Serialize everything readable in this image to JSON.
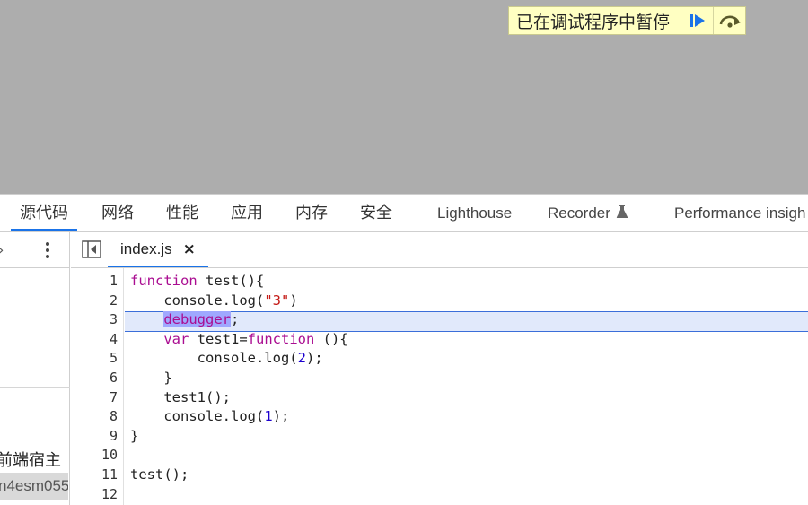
{
  "overlay": {
    "paused_text": "已在调试程序中暂停",
    "resume_icon": "resume-icon",
    "step_over_icon": "step-over-icon"
  },
  "tabs": [
    {
      "label": "源代码",
      "active": true
    },
    {
      "label": "网络"
    },
    {
      "label": "性能"
    },
    {
      "label": "应用"
    },
    {
      "label": "内存"
    },
    {
      "label": "安全"
    },
    {
      "label": "Lighthouse"
    },
    {
      "label": "Recorder"
    },
    {
      "label": "Performance insigh"
    }
  ],
  "sidebar": {
    "author": "前端宿主",
    "id_text": "n4esm055"
  },
  "editor": {
    "file_tab": "index.js",
    "close_label": "×",
    "line_numbers": [
      "1",
      "2",
      "3",
      "4",
      "5",
      "6",
      "7",
      "8",
      "9",
      "10",
      "11",
      "12"
    ],
    "code": [
      {
        "indent": "",
        "tokens": [
          [
            "kw",
            "function"
          ],
          [
            "p",
            " test(){"
          ]
        ]
      },
      {
        "indent": "    ",
        "tokens": [
          [
            "p",
            "console.log("
          ],
          [
            "str",
            "\"3\""
          ],
          [
            "p",
            ")"
          ]
        ]
      },
      {
        "indent": "    ",
        "tokens": [
          [
            "dbg",
            "debugger"
          ],
          [
            "p",
            ";"
          ]
        ]
      },
      {
        "indent": "    ",
        "tokens": [
          [
            "kw",
            "var"
          ],
          [
            "p",
            " test1="
          ],
          [
            "kw",
            "function"
          ],
          [
            "p",
            " (){"
          ]
        ]
      },
      {
        "indent": "        ",
        "tokens": [
          [
            "p",
            "console.log("
          ],
          [
            "num",
            "2"
          ],
          [
            "p",
            ");"
          ]
        ]
      },
      {
        "indent": "    ",
        "tokens": [
          [
            "p",
            "}"
          ]
        ]
      },
      {
        "indent": "    ",
        "tokens": [
          [
            "p",
            "test1();"
          ]
        ]
      },
      {
        "indent": "    ",
        "tokens": [
          [
            "p",
            "console.log("
          ],
          [
            "num",
            "1"
          ],
          [
            "p",
            ");"
          ]
        ]
      },
      {
        "indent": "",
        "tokens": [
          [
            "p",
            "}"
          ]
        ]
      },
      {
        "indent": "",
        "tokens": []
      },
      {
        "indent": "",
        "tokens": [
          [
            "p",
            "test();"
          ]
        ]
      },
      {
        "indent": "",
        "tokens": []
      }
    ]
  },
  "colors": {
    "accent": "#1a73e8",
    "keyword": "#aa0d91",
    "string": "#c41a16",
    "number": "#1c00cf",
    "paused_bg": "#ffffc2",
    "page_bg": "#adadad"
  }
}
